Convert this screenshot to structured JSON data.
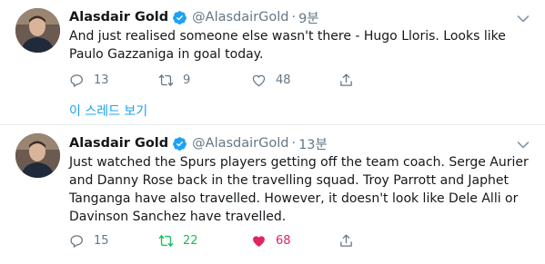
{
  "tweets": [
    {
      "name": "Alasdair Gold",
      "handle": "@AlasdairGold",
      "separator": "·",
      "time": "9분",
      "lines": [
        "And just realised someone else wasn't there - Hugo Lloris. Looks like",
        "Paulo Gazzaniga in goal today."
      ],
      "replies": "13",
      "retweets": "9",
      "likes": "48",
      "retweeted": false,
      "liked": false
    },
    {
      "name": "Alasdair Gold",
      "handle": "@AlasdairGold",
      "separator": "·",
      "time": "13분",
      "lines": [
        "Just watched the Spurs players getting off the team coach. Serge Aurier",
        "and Danny Rose back in the travelling squad. Troy Parrott and Japhet",
        "Tanganga have also travelled. However, it doesn't look like Dele Alli or",
        "Davinson Sanchez have travelled."
      ],
      "replies": "15",
      "retweets": "22",
      "likes": "68",
      "retweeted": true,
      "liked": true
    }
  ],
  "thread_link": "이 스레드 보기",
  "icons": {
    "verified": "verified-badge-icon",
    "menu": "chevron-down-icon",
    "reply": "reply-icon",
    "retweet": "retweet-icon",
    "like": "heart-icon",
    "share": "share-icon"
  },
  "colors": {
    "accent": "#1da1f2",
    "retweet_active": "#17bf63",
    "like_active": "#e0245e",
    "muted": "#657786",
    "divider": "#e6ecf0"
  }
}
